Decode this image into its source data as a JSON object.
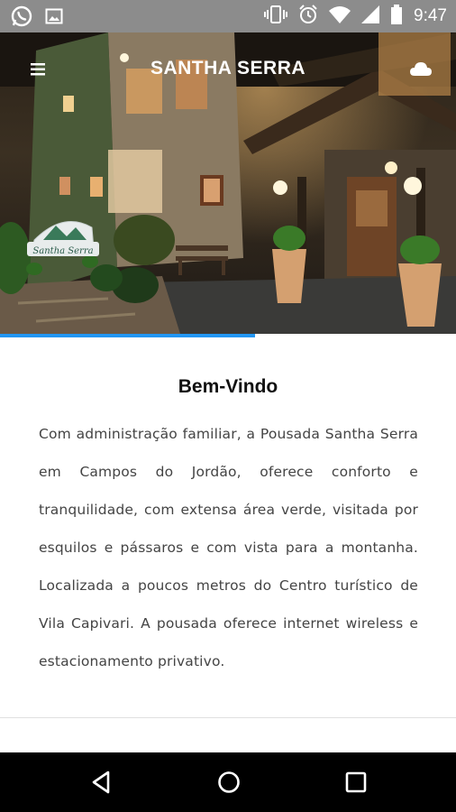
{
  "status_bar": {
    "time": "9:47",
    "left_icons": [
      "whatsapp-icon",
      "image-icon"
    ],
    "right_icons": [
      "vibrate-icon",
      "alarm-icon",
      "wifi-icon",
      "signal-icon",
      "battery-icon"
    ]
  },
  "header": {
    "title": "SANTHA SERRA",
    "menu_icon": "menu-icon",
    "right_icon": "cloud-icon"
  },
  "hero": {
    "sign_text": "Santha Serra"
  },
  "loading": {
    "progress": 0.56,
    "color": "#2196f3"
  },
  "welcome": {
    "heading": "Bem-Vindo",
    "body": "Com administração familiar, a Pousada Santha Serra em Campos do Jordão, oferece conforto e tranquilidade, com extensa área verde, visitada por esquilos e pássaros e com vista para a montanha. Localizada a poucos metros do Centro turístico de Vila Capivari. A pousada oferece internet wireless e estacionamento privativo."
  },
  "nav": {
    "buttons": [
      "back-icon",
      "home-icon",
      "recents-icon"
    ]
  },
  "colors": {
    "status_bar": "#8c8c8c",
    "nav_bar": "#000000",
    "accent": "#2196f3"
  }
}
